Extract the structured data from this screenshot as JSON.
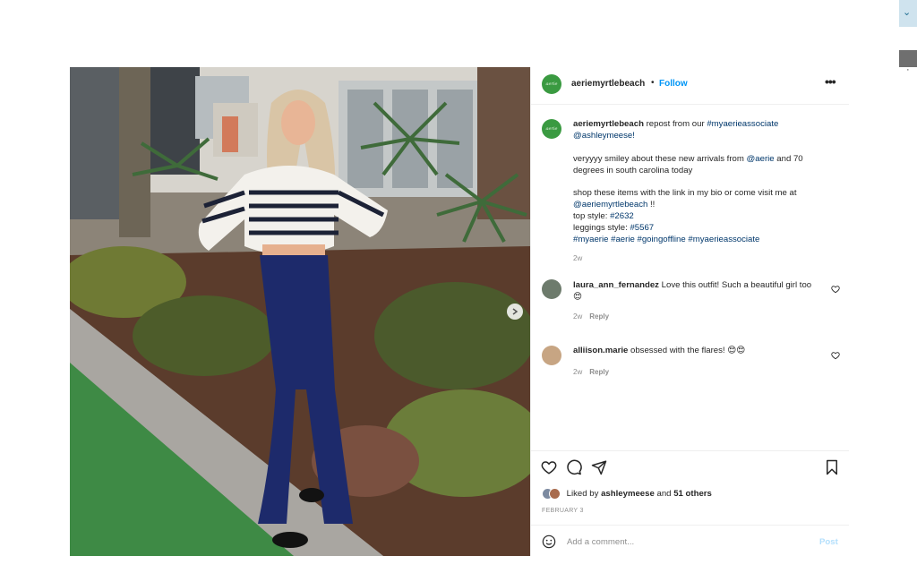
{
  "post": {
    "username": "aeriemyrtlebeach",
    "dot": "•",
    "follow": "Follow",
    "avatar_text": "aerie"
  },
  "caption": {
    "username": "aeriemyrtlebeach",
    "line1_text": "repost from our",
    "line1_tag": "#myaerieassociate",
    "line2_mention": "@ashleymeese!",
    "para2_a": "veryyyy smiley about these new arrivals from",
    "para2_mention": "@aerie",
    "para2_b": "and 70 degrees in south carolina today",
    "para3": "shop these items with the link in my bio or come visit me at",
    "para3_mention": "@aeriemyrtlebeach",
    "para3_end": "!!",
    "top_label": "top style:",
    "top_tag": "#2632",
    "leggings_label": "leggings style:",
    "leggings_tag": "#5567",
    "hashtags": [
      "#myaerie",
      "#aerie",
      "#goingoffline",
      "#myaerieassociate"
    ],
    "time": "2w"
  },
  "comments": [
    {
      "username": "laura_ann_fernandez",
      "text": "Love this outfit! Such a beautiful girl too 😍",
      "time": "2w",
      "reply": "Reply",
      "avatar_color": "#6d7b6c"
    },
    {
      "username": "alliison.marie",
      "text": "obsessed with the flares! 😍😍",
      "time": "2w",
      "reply": "Reply",
      "avatar_color": "#c7a583"
    }
  ],
  "likes": {
    "prefix": "Liked by",
    "user": "ashleymeese",
    "and": "and",
    "others": "51 others"
  },
  "date": "FEBRUARY 3",
  "add_comment": {
    "placeholder": "Add a comment...",
    "post": "Post"
  },
  "icons": {
    "like": "heart-icon",
    "comment": "comment-icon",
    "share": "send-icon",
    "save": "bookmark-icon",
    "emoji": "smiley-icon",
    "more": "more-options-icon",
    "next": "chevron-right-icon"
  },
  "colors": {
    "link_blue": "#0095f6",
    "tag_blue": "#00376b",
    "brand_green": "#3a9a41",
    "muted": "#8e8e8e"
  }
}
